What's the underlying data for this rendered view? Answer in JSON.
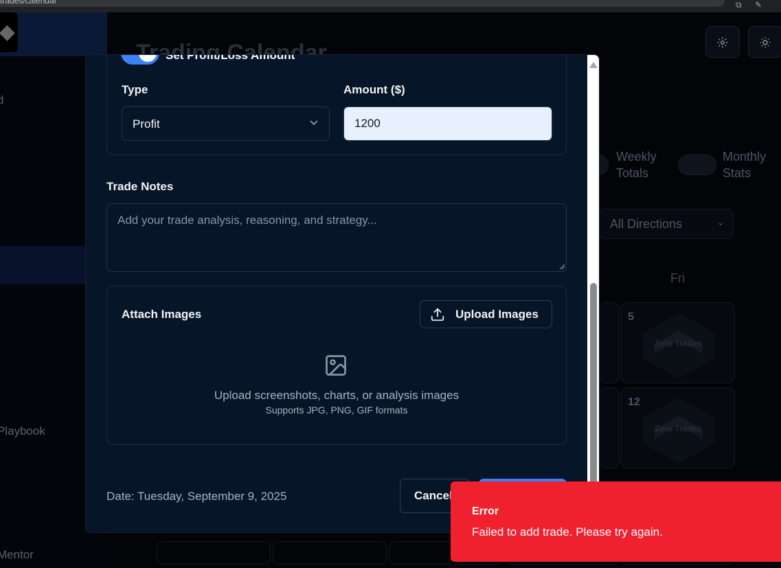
{
  "browser": {
    "url": "trades/calendar"
  },
  "background": {
    "page_title": "Trading Calendar",
    "sidebar_items": [
      "d",
      "Playbook",
      "Mentor"
    ],
    "header_icons": [
      "gear-icon",
      "sun-icon"
    ],
    "toggles": [
      {
        "label_line1": "Weekly",
        "label_line2": "Totals"
      },
      {
        "label_line1": "Monthly",
        "label_line2": "Stats"
      }
    ],
    "direction_filter": "All Directions",
    "day_header": "Fri",
    "cells": [
      {
        "day": "5",
        "label": "Zero Trades"
      },
      {
        "day": "12",
        "label": "Zero Trades"
      }
    ]
  },
  "modal": {
    "switch_label": "Set Profit/Loss Amount",
    "type_label": "Type",
    "type_value": "Profit",
    "amount_label": "Amount ($)",
    "amount_value": "1200",
    "notes_label": "Trade Notes",
    "notes_placeholder": "Add your trade analysis, reasoning, and strategy...",
    "attach_title": "Attach Images",
    "upload_button": "Upload Images",
    "upload_hint": "Upload screenshots, charts, or analysis images",
    "upload_formats": "Supports JPG, PNG, GIF formats",
    "date_text": "Date: Tuesday, September 9, 2025",
    "cancel_button": "Cancel"
  },
  "toast": {
    "title": "Error",
    "message": "Failed to add trade. Please try again."
  },
  "colors": {
    "accent": "#3b82f6",
    "error": "#f0212f",
    "modal_bg": "#061527"
  }
}
